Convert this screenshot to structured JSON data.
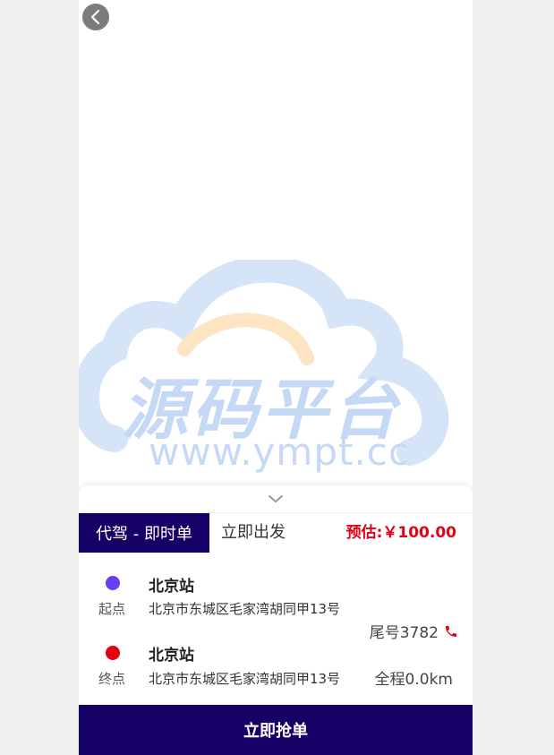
{
  "watermark": {
    "title": "源码平台",
    "url": "www.ympt.cc"
  },
  "order": {
    "tag": "代驾 - 即时单",
    "depart": "立即出发",
    "estimate": "预估:￥100.00",
    "tail_number": "尾号3782",
    "distance": "全程0.0km"
  },
  "start": {
    "label": "起点",
    "name": "北京站",
    "address": "北京市东城区毛家湾胡同甲13号"
  },
  "end": {
    "label": "终点",
    "name": "北京站",
    "address": "北京市东城区毛家湾胡同甲13号"
  },
  "action": {
    "grab_label": "立即抢单"
  },
  "colors": {
    "primary": "#150065",
    "price": "#e60012",
    "start_dot": "#6a3ff0",
    "end_dot": "#e60012",
    "watermark_blue": "#c5d8f6",
    "watermark_orange": "#fde4c2"
  },
  "icons": {
    "back": "chevron-left-icon",
    "collapse": "chevron-down-icon",
    "phone": "phone-icon"
  }
}
